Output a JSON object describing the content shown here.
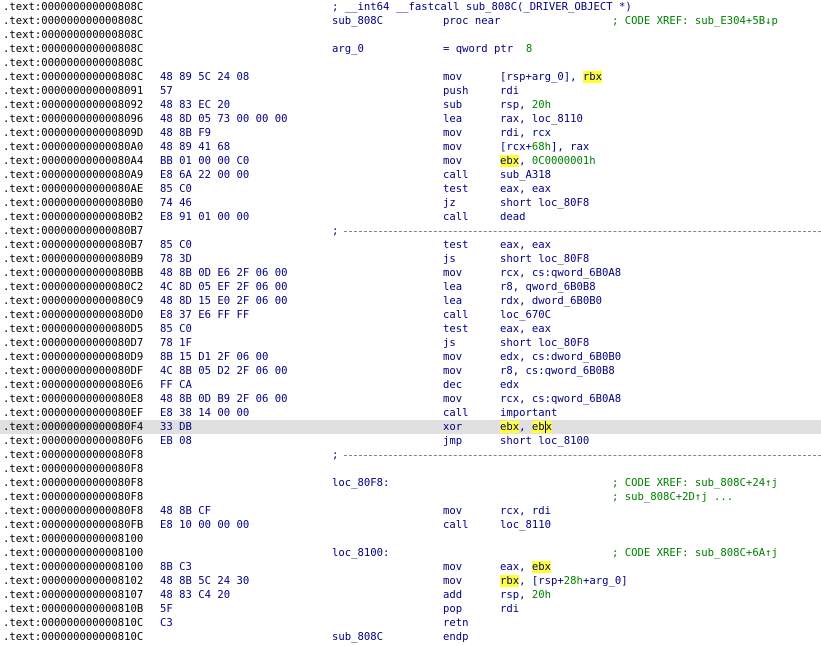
{
  "colors": {
    "background": "#ffffff",
    "address_text": "#000000",
    "code_text": "#000080",
    "number_text": "#008000",
    "comment_text": "#008000",
    "highlight": "#ffff33",
    "selected_line": "#e0e0e0"
  },
  "lines": [
    {
      "addr": ".text:000000000000808C",
      "hdr": "; __int64 __fastcall sub_808C(_DRIVER_OBJECT *)"
    },
    {
      "addr": ".text:000000000000808C",
      "label": "sub_808C",
      "mnem": "proc near",
      "cmt": "; CODE XREF: sub_E304+5B↓p"
    },
    {
      "addr": ".text:000000000000808C"
    },
    {
      "addr": ".text:000000000000808C",
      "label": "arg_0",
      "eq": "= qword ptr  8"
    },
    {
      "addr": ".text:000000000000808C"
    },
    {
      "addr": ".text:000000000000808C",
      "bytes": "48 89 5C 24 08",
      "mnem": "mov",
      "ops": "[rsp+arg_0], rbx"
    },
    {
      "addr": ".text:0000000000008091",
      "bytes": "57",
      "mnem": "push",
      "ops": "rdi"
    },
    {
      "addr": ".text:0000000000008092",
      "bytes": "48 83 EC 20",
      "mnem": "sub",
      "ops": "rsp, 20h"
    },
    {
      "addr": ".text:0000000000008096",
      "bytes": "48 8D 05 73 00 00 00",
      "mnem": "lea",
      "ops": "rax, loc_8110"
    },
    {
      "addr": ".text:000000000000809D",
      "bytes": "48 8B F9",
      "mnem": "mov",
      "ops": "rdi, rcx"
    },
    {
      "addr": ".text:00000000000080A0",
      "bytes": "48 89 41 68",
      "mnem": "mov",
      "ops": "[rcx+68h], rax"
    },
    {
      "addr": ".text:00000000000080A4",
      "bytes": "BB 01 00 00 C0",
      "mnem": "mov",
      "ops": "ebx, 0C0000001h"
    },
    {
      "addr": ".text:00000000000080A9",
      "bytes": "E8 6A 22 00 00",
      "mnem": "call",
      "ops": "sub_A318"
    },
    {
      "addr": ".text:00000000000080AE",
      "bytes": "85 C0",
      "mnem": "test",
      "ops": "eax, eax"
    },
    {
      "addr": ".text:00000000000080B0",
      "bytes": "74 46",
      "mnem": "jz",
      "ops": "short loc_80F8"
    },
    {
      "addr": ".text:00000000000080B2",
      "bytes": "E8 91 01 00 00",
      "mnem": "call",
      "ops": "dead"
    },
    {
      "addr": ".text:00000000000080B7",
      "sep": ";"
    },
    {
      "addr": ".text:00000000000080B7",
      "bytes": "85 C0",
      "mnem": "test",
      "ops": "eax, eax"
    },
    {
      "addr": ".text:00000000000080B9",
      "bytes": "78 3D",
      "mnem": "js",
      "ops": "short loc_80F8"
    },
    {
      "addr": ".text:00000000000080BB",
      "bytes": "48 8B 0D E6 2F 06 00",
      "mnem": "mov",
      "ops": "rcx, cs:qword_6B0A8"
    },
    {
      "addr": ".text:00000000000080C2",
      "bytes": "4C 8D 05 EF 2F 06 00",
      "mnem": "lea",
      "ops": "r8, qword_6B0B8"
    },
    {
      "addr": ".text:00000000000080C9",
      "bytes": "48 8D 15 E0 2F 06 00",
      "mnem": "lea",
      "ops": "rdx, dword_6B0B0"
    },
    {
      "addr": ".text:00000000000080D0",
      "bytes": "E8 37 E6 FF FF",
      "mnem": "call",
      "ops": "loc_670C"
    },
    {
      "addr": ".text:00000000000080D5",
      "bytes": "85 C0",
      "mnem": "test",
      "ops": "eax, eax"
    },
    {
      "addr": ".text:00000000000080D7",
      "bytes": "78 1F",
      "mnem": "js",
      "ops": "short loc_80F8"
    },
    {
      "addr": ".text:00000000000080D9",
      "bytes": "8B 15 D1 2F 06 00",
      "mnem": "mov",
      "ops": "edx, cs:dword_6B0B0"
    },
    {
      "addr": ".text:00000000000080DF",
      "bytes": "4C 8B 05 D2 2F 06 00",
      "mnem": "mov",
      "ops": "r8, cs:qword_6B0B8"
    },
    {
      "addr": ".text:00000000000080E6",
      "bytes": "FF CA",
      "mnem": "dec",
      "ops": "edx"
    },
    {
      "addr": ".text:00000000000080E8",
      "bytes": "48 8B 0D B9 2F 06 00",
      "mnem": "mov",
      "ops": "rcx, cs:qword_6B0A8"
    },
    {
      "addr": ".text:00000000000080EF",
      "bytes": "E8 38 14 00 00",
      "mnem": "call",
      "ops": "important"
    },
    {
      "addr": ".text:00000000000080F4",
      "bytes": "33 DB",
      "mnem": "xor",
      "ops": "ebx, ebx",
      "selected": true
    },
    {
      "addr": ".text:00000000000080F6",
      "bytes": "EB 08",
      "mnem": "jmp",
      "ops": "short loc_8100"
    },
    {
      "addr": ".text:00000000000080F8",
      "sep": ";"
    },
    {
      "addr": ".text:00000000000080F8"
    },
    {
      "addr": ".text:00000000000080F8",
      "label": "loc_80F8:",
      "cmt": "; CODE XREF: sub_808C+24↑j"
    },
    {
      "addr": ".text:00000000000080F8",
      "cmt": "; sub_808C+2D↑j ..."
    },
    {
      "addr": ".text:00000000000080F8",
      "bytes": "48 8B CF",
      "mnem": "mov",
      "ops": "rcx, rdi"
    },
    {
      "addr": ".text:00000000000080FB",
      "bytes": "E8 10 00 00 00",
      "mnem": "call",
      "ops": "loc_8110"
    },
    {
      "addr": ".text:0000000000008100"
    },
    {
      "addr": ".text:0000000000008100",
      "label": "loc_8100:",
      "cmt": "; CODE XREF: sub_808C+6A↑j"
    },
    {
      "addr": ".text:0000000000008100",
      "bytes": "8B C3",
      "mnem": "mov",
      "ops": "eax, ebx"
    },
    {
      "addr": ".text:0000000000008102",
      "bytes": "48 8B 5C 24 30",
      "mnem": "mov",
      "ops": "rbx, [rsp+28h+arg_0]"
    },
    {
      "addr": ".text:0000000000008107",
      "bytes": "48 83 C4 20",
      "mnem": "add",
      "ops": "rsp, 20h"
    },
    {
      "addr": ".text:000000000000810B",
      "bytes": "5F",
      "mnem": "pop",
      "ops": "rdi"
    },
    {
      "addr": ".text:000000000000810C",
      "bytes": "C3",
      "mnem": "retn"
    },
    {
      "addr": ".text:000000000000810C",
      "label": "sub_808C",
      "mnem": "endp"
    }
  ]
}
